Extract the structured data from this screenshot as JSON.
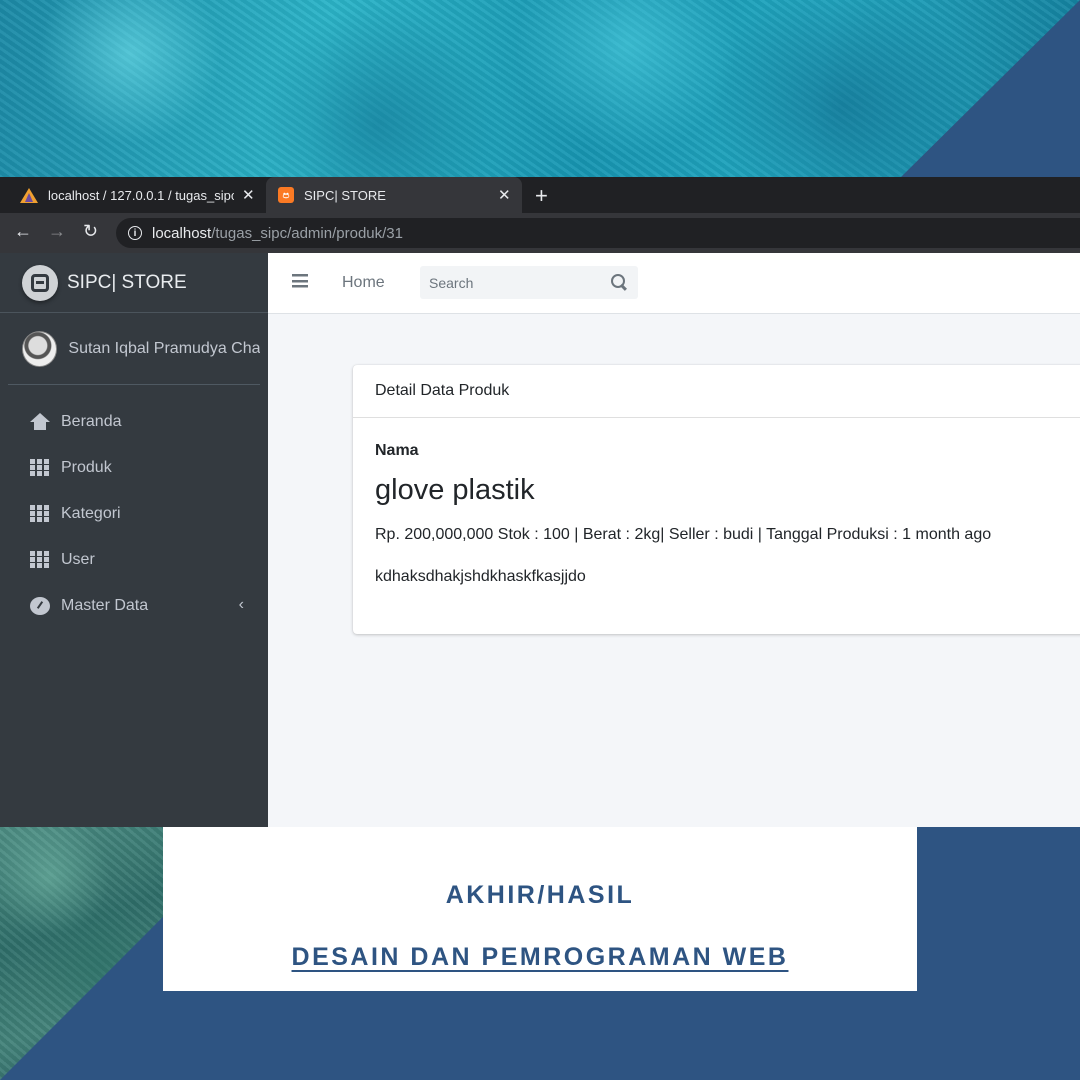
{
  "browser": {
    "tabs": [
      {
        "title": "localhost / 127.0.0.1 / tugas_sipc",
        "icon": "phpmyadmin-icon"
      },
      {
        "title": "SIPC| STORE",
        "icon": "xampp-icon"
      }
    ],
    "url_host": "localhost",
    "url_path": "/tugas_sipc/admin/produk/31"
  },
  "sidebar": {
    "brand": "SIPC| STORE",
    "user_name": "Sutan Iqbal Pramudya Cha",
    "items": [
      {
        "label": "Beranda",
        "icon": "home-icon"
      },
      {
        "label": "Produk",
        "icon": "grid-icon"
      },
      {
        "label": "Kategori",
        "icon": "grid-icon"
      },
      {
        "label": "User",
        "icon": "grid-icon"
      },
      {
        "label": "Master Data",
        "icon": "gauge-icon"
      }
    ]
  },
  "topnav": {
    "home": "Home",
    "search_placeholder": "Search"
  },
  "card": {
    "header": "Detail Data Produk",
    "field_label": "Nama",
    "product_name": "glove plastik",
    "meta": "Rp. 200,000,000 Stok : 100 | Berat : 2kg| Seller : budi | Tanggal Produksi : 1 month ago",
    "description": "kdhaksdhakjshdkhaskfkasjjdo"
  },
  "banner": {
    "title": "AKHIR/HASIL",
    "subtitle": "DESAIN DAN PEMROGRAMAN WEB"
  },
  "colors": {
    "sidebar_bg": "#343a40",
    "accent_blue": "#2e5482",
    "content_bg": "#f4f6f9"
  }
}
